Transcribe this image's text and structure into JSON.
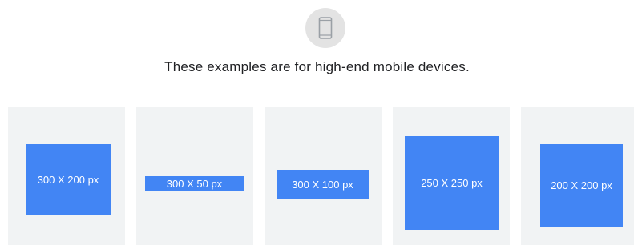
{
  "icon": {
    "name": "mobile-phone-icon",
    "circle_color": "#e3e3e3",
    "stroke_color": "#9aa0a6"
  },
  "heading": "These examples are for high-end mobile devices.",
  "panel_color": "#f1f3f4",
  "ad_color": "#4285f4",
  "examples": [
    {
      "label": "300 X 200 px"
    },
    {
      "label": "300 X 50 px"
    },
    {
      "label": "300 X 100 px"
    },
    {
      "label": "250 X 250 px"
    },
    {
      "label": "200 X 200 px"
    }
  ]
}
